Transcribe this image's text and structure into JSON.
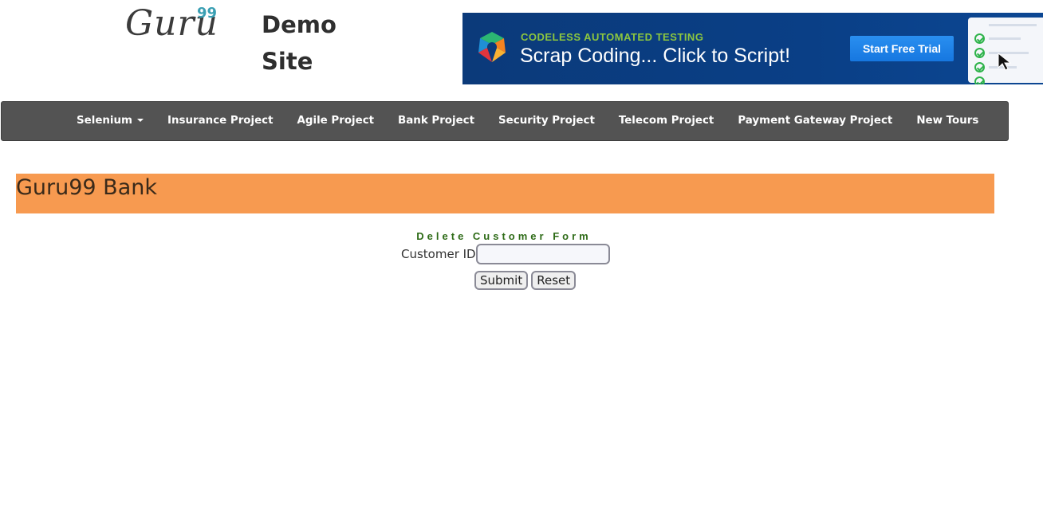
{
  "header": {
    "logo_word": "Guru",
    "logo_sup": "99",
    "site_title": "Demo Site"
  },
  "ad": {
    "kicker": "CODELESS AUTOMATED TESTING",
    "headline": "Scrap Coding... Click to Script!",
    "button_label": "Start Free Trial"
  },
  "nav": {
    "items": [
      {
        "label": "Selenium",
        "dropdown": true
      },
      {
        "label": "Insurance Project"
      },
      {
        "label": "Agile Project"
      },
      {
        "label": "Bank Project"
      },
      {
        "label": "Security Project"
      },
      {
        "label": "Telecom Project"
      },
      {
        "label": "Payment Gateway Project"
      },
      {
        "label": "New Tours"
      }
    ]
  },
  "bank": {
    "title": "Guru99 Bank"
  },
  "form": {
    "title": "Delete Customer Form",
    "customer_id_label": "Customer ID",
    "customer_id_value": "",
    "submit_label": "Submit",
    "reset_label": "Reset"
  },
  "colors": {
    "navbar": "#535353",
    "banner": "#f79a50",
    "form_title": "#2e6b17",
    "logo_accent": "#3a9fb3"
  }
}
